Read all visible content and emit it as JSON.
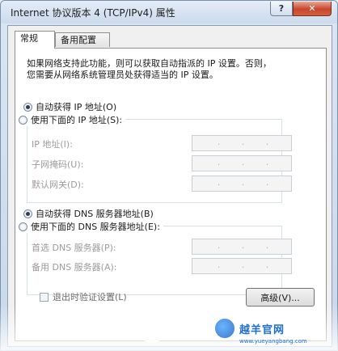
{
  "window": {
    "title": "Internet 协议版本 4 (TCP/IPv4) 属性",
    "help_glyph": "?",
    "close_glyph": "✕"
  },
  "tabs": [
    {
      "label": "常规",
      "active": true
    },
    {
      "label": "备用配置",
      "active": false
    }
  ],
  "description": {
    "line1": "如果网络支持此功能，则可以获取自动指派的 IP 设置。否则，",
    "line2": "您需要从网络系统管理员处获得适当的 IP 设置。"
  },
  "ip_section": {
    "auto_label": "自动获得 IP 地址(O)",
    "auto_checked": true,
    "manual_label": "使用下面的 IP 地址(S):",
    "manual_checked": false,
    "fields": [
      {
        "label": "IP 地址(I):",
        "value": ""
      },
      {
        "label": "子网掩码(U):",
        "value": ""
      },
      {
        "label": "默认网关(D):",
        "value": ""
      }
    ]
  },
  "dns_section": {
    "auto_label": "自动获得 DNS 服务器地址(B)",
    "auto_checked": true,
    "manual_label": "使用下面的 DNS 服务器地址(E):",
    "manual_checked": false,
    "fields": [
      {
        "label": "首选 DNS 服务器(P):",
        "value": ""
      },
      {
        "label": "备用 DNS 服务器(A):",
        "value": ""
      }
    ]
  },
  "validate_on_exit": {
    "label": "退出时验证设置(L)",
    "checked": false
  },
  "advanced_button": "高级(V)...",
  "watermark": {
    "brand": "越羊官网",
    "url": "www.yueyangbang.com"
  },
  "colors": {
    "brand_blue": "#1e6fd0",
    "close_red": "#c8452d"
  }
}
